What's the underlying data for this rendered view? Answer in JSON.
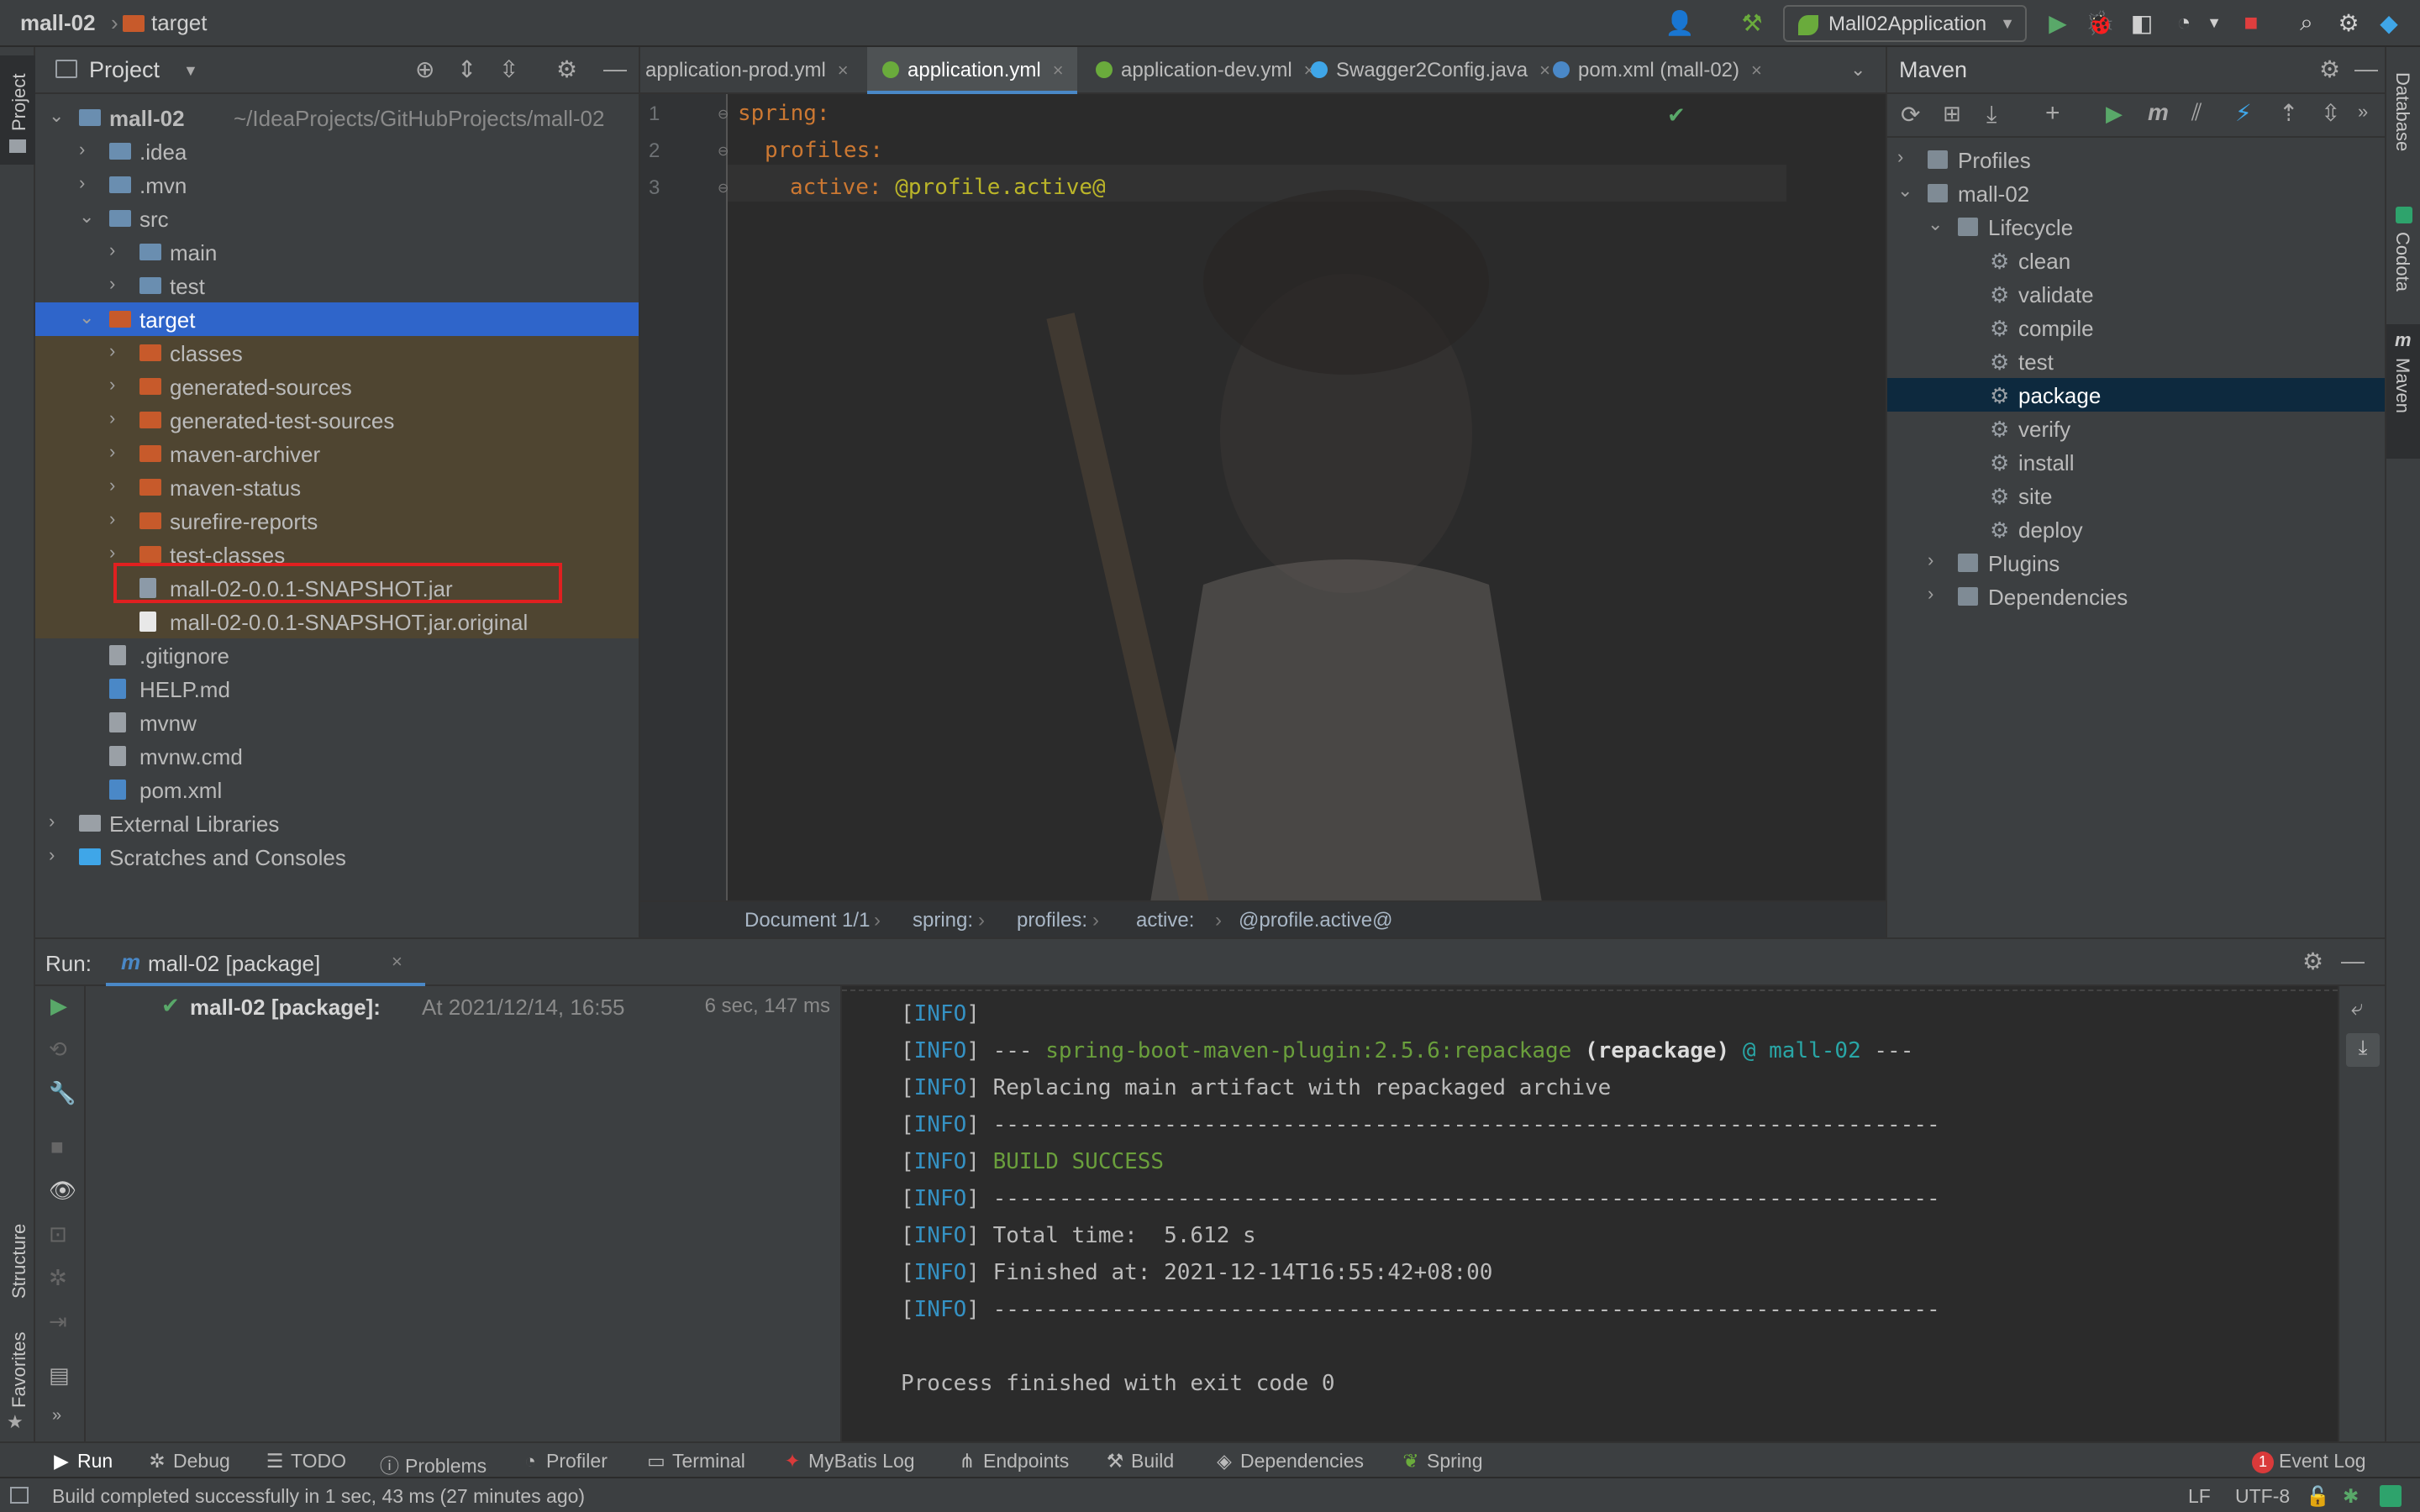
{
  "titlebar": {
    "project": "mall-02",
    "folder": "target",
    "run_config": "Mall02Application"
  },
  "project_panel": {
    "title": "Project",
    "tree": [
      {
        "label": "mall-02",
        "hint": "~/IdeaProjects/GitHubProjects/mall-02",
        "depth": 0,
        "icon": "module-folder-icon",
        "expanded": true
      },
      {
        "label": ".idea",
        "depth": 1,
        "icon": "folder-icon"
      },
      {
        "label": ".mvn",
        "depth": 1,
        "icon": "folder-icon"
      },
      {
        "label": "src",
        "depth": 1,
        "icon": "folder-icon",
        "expanded": true
      },
      {
        "label": "main",
        "depth": 2,
        "icon": "folder-icon"
      },
      {
        "label": "test",
        "depth": 2,
        "icon": "folder-icon"
      },
      {
        "label": "target",
        "depth": 1,
        "icon": "excluded-folder-icon",
        "expanded": true,
        "selected": true
      },
      {
        "label": "classes",
        "depth": 2,
        "icon": "excluded-folder-icon"
      },
      {
        "label": "generated-sources",
        "depth": 2,
        "icon": "excluded-folder-icon"
      },
      {
        "label": "generated-test-sources",
        "depth": 2,
        "icon": "excluded-folder-icon"
      },
      {
        "label": "maven-archiver",
        "depth": 2,
        "icon": "excluded-folder-icon"
      },
      {
        "label": "maven-status",
        "depth": 2,
        "icon": "excluded-folder-icon"
      },
      {
        "label": "surefire-reports",
        "depth": 2,
        "icon": "excluded-folder-icon"
      },
      {
        "label": "test-classes",
        "depth": 2,
        "icon": "excluded-folder-icon"
      },
      {
        "label": "mall-02-0.0.1-SNAPSHOT.jar",
        "depth": 2,
        "icon": "jar-file-icon",
        "leaf": true,
        "highlighted": true
      },
      {
        "label": "mall-02-0.0.1-SNAPSHOT.jar.original",
        "depth": 2,
        "icon": "file-icon",
        "leaf": true
      },
      {
        "label": ".gitignore",
        "depth": 1,
        "icon": "gitignore-file-icon",
        "leaf": true
      },
      {
        "label": "HELP.md",
        "depth": 1,
        "icon": "markdown-file-icon",
        "leaf": true
      },
      {
        "label": "mvnw",
        "depth": 1,
        "icon": "shell-file-icon",
        "leaf": true
      },
      {
        "label": "mvnw.cmd",
        "depth": 1,
        "icon": "cmd-file-icon",
        "leaf": true
      },
      {
        "label": "pom.xml",
        "depth": 1,
        "icon": "maven-file-icon",
        "leaf": true
      },
      {
        "label": "External Libraries",
        "depth": 0,
        "icon": "libraries-icon"
      },
      {
        "label": "Scratches and Consoles",
        "depth": 0,
        "icon": "scratches-icon"
      }
    ]
  },
  "editor": {
    "tabs": [
      {
        "label": "application-prod.yml",
        "active": false
      },
      {
        "label": "application.yml",
        "active": true
      },
      {
        "label": "application-dev.yml",
        "active": false
      },
      {
        "label": "Swagger2Config.java",
        "active": false
      },
      {
        "label": "pom.xml (mall-02)",
        "active": false
      }
    ],
    "lines": [
      {
        "num": "1",
        "key": "spring",
        "sep": ":",
        "value": ""
      },
      {
        "num": "2",
        "key": "profiles",
        "sep": ":",
        "value": ""
      },
      {
        "num": "3",
        "key": "active",
        "sep": ": ",
        "value": "@profile.active@"
      }
    ],
    "breadcrumbs": [
      "Document 1/1",
      "spring:",
      "profiles:",
      "active:",
      "@profile.active@"
    ]
  },
  "maven_panel": {
    "title": "Maven",
    "tree": [
      {
        "label": "Profiles",
        "depth": 0
      },
      {
        "label": "mall-02",
        "depth": 0,
        "expanded": true
      },
      {
        "label": "Lifecycle",
        "depth": 1,
        "expanded": true
      },
      {
        "label": "clean",
        "depth": 2,
        "goal": true
      },
      {
        "label": "validate",
        "depth": 2,
        "goal": true
      },
      {
        "label": "compile",
        "depth": 2,
        "goal": true
      },
      {
        "label": "test",
        "depth": 2,
        "goal": true
      },
      {
        "label": "package",
        "depth": 2,
        "goal": true,
        "selected": true
      },
      {
        "label": "verify",
        "depth": 2,
        "goal": true
      },
      {
        "label": "install",
        "depth": 2,
        "goal": true
      },
      {
        "label": "site",
        "depth": 2,
        "goal": true
      },
      {
        "label": "deploy",
        "depth": 2,
        "goal": true
      },
      {
        "label": "Plugins",
        "depth": 1
      },
      {
        "label": "Dependencies",
        "depth": 1
      }
    ]
  },
  "right_stripe": [
    "Database",
    "Codota",
    "Maven"
  ],
  "left_stripe": {
    "top": "Project",
    "structure": "Structure",
    "favorites": "Favorites"
  },
  "run_panel": {
    "label": "Run:",
    "tab": "mall-02 [package]",
    "tree_item": {
      "name": "mall-02 [package]:",
      "detail": "At 2021/12/14, 16:55",
      "duration": "6 sec, 147 ms"
    },
    "console": [
      "[INFO]",
      "[INFO] --- spring-boot-maven-plugin:2.5.6:repackage (repackage) @ mall-02 ---",
      "[INFO] Replacing main artifact with repackaged archive",
      "[INFO] ------------------------------------------------------------------------",
      "[INFO] BUILD SUCCESS",
      "[INFO] ------------------------------------------------------------------------",
      "[INFO] Total time:  5.612 s",
      "[INFO] Finished at: 2021-12-14T16:55:42+08:00",
      "[INFO] ------------------------------------------------------------------------",
      "",
      "Process finished with exit code 0"
    ]
  },
  "bottom_tools": [
    {
      "label": "Run",
      "icon": "play-icon",
      "active": true
    },
    {
      "label": "Debug",
      "icon": "bug-icon"
    },
    {
      "label": "TODO",
      "icon": "list-icon"
    },
    {
      "label": "Problems",
      "icon": "info-icon"
    },
    {
      "label": "Profiler",
      "icon": "profiler-icon"
    },
    {
      "label": "Terminal",
      "icon": "terminal-icon"
    },
    {
      "label": "MyBatis Log",
      "icon": "mybatis-icon"
    },
    {
      "label": "Endpoints",
      "icon": "endpoints-icon"
    },
    {
      "label": "Build",
      "icon": "hammer-icon"
    },
    {
      "label": "Dependencies",
      "icon": "dependencies-icon"
    },
    {
      "label": "Spring",
      "icon": "spring-leaf-icon"
    }
  ],
  "event_log": {
    "label": "Event Log",
    "count": "1"
  },
  "statusbar": {
    "message": "Build completed successfully in 1 sec, 43 ms (27 minutes ago)",
    "line_sep": "LF",
    "encoding": "UTF-8"
  }
}
